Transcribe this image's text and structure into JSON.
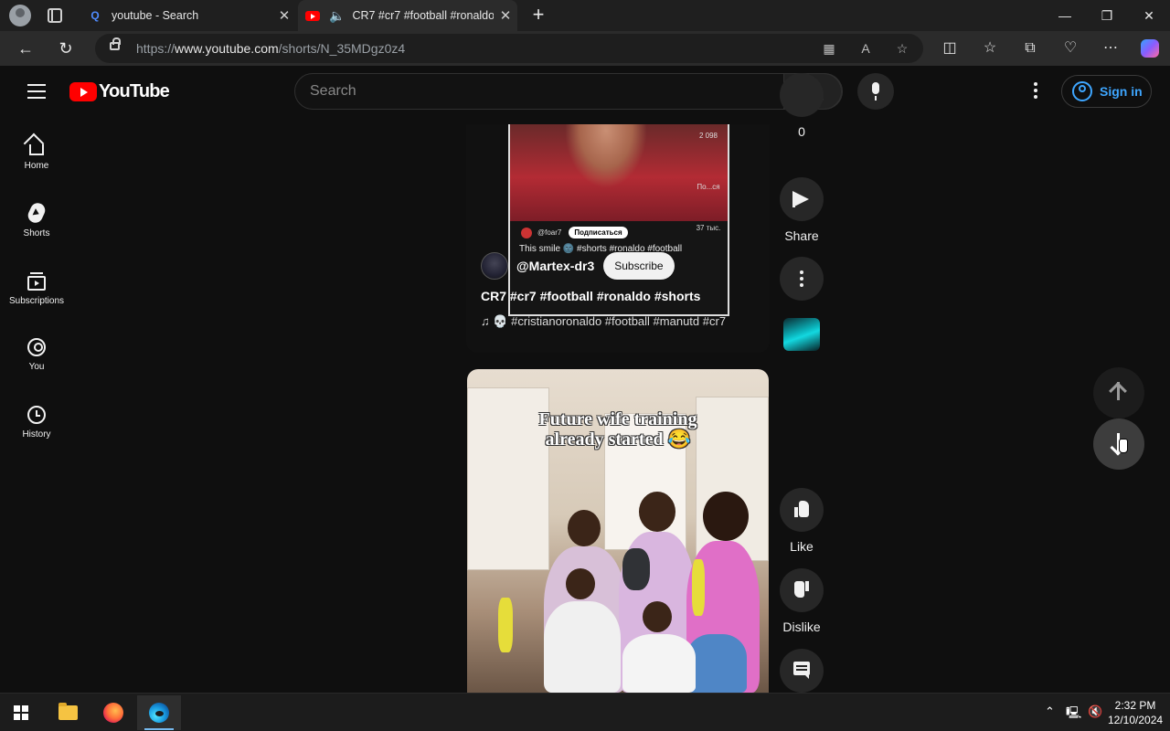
{
  "browser": {
    "tabs": [
      {
        "title": "youtube - Search",
        "favicon": "search-icon",
        "active": false
      },
      {
        "title": "CR7 #cr7 #football #ronaldo",
        "favicon": "youtube-icon",
        "active": true,
        "audio": true
      }
    ],
    "url_prefix": "https://",
    "url_domain": "www.youtube.com",
    "url_path": "/shorts/N_35MDgz0z4"
  },
  "masthead": {
    "logo_text": "YouTube",
    "search_placeholder": "Search",
    "signin_label": "Sign in"
  },
  "sidebar": {
    "items": [
      {
        "label": "Home",
        "icon": "home-icon"
      },
      {
        "label": "Shorts",
        "icon": "shorts-icon"
      },
      {
        "label": "Subscriptions",
        "icon": "subscriptions-icon"
      },
      {
        "label": "You",
        "icon": "you-icon"
      },
      {
        "label": "History",
        "icon": "history-icon"
      }
    ]
  },
  "short_current": {
    "embedded_user": "@foar7",
    "embedded_subscribe": "Подписаться",
    "embedded_caption": "This smile 🌚 #shorts #ronaldo #football",
    "embedded_stats": [
      "2 098",
      "По...ся",
      "37 тыс."
    ],
    "channel_handle": "@Martex-dr3",
    "subscribe_label": "Subscribe",
    "title": "CR7 #cr7 #football #ronaldo #shorts",
    "audio": "💀 #cristianoronaldo #football #manutd #cr7",
    "dislike_count": "0",
    "share_label": "Share"
  },
  "short_next": {
    "caption_line1": "Future wife training",
    "caption_line2": "already started 😂",
    "like_label": "Like",
    "dislike_label": "Dislike"
  },
  "taskbar": {
    "time": "2:32 PM",
    "date": "12/10/2024"
  },
  "colors": {
    "youtube_red": "#ff0000",
    "link_blue": "#3ea6ff",
    "background": "#0f0f0f"
  }
}
